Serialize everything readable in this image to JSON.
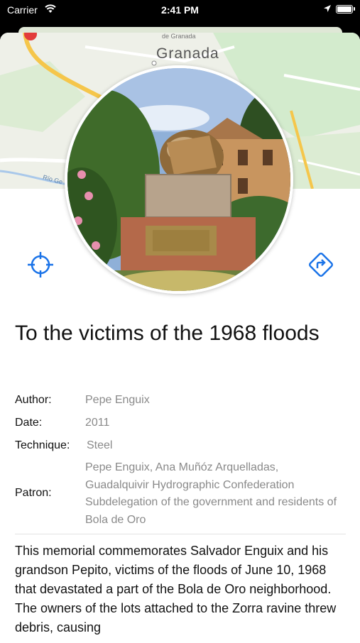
{
  "status_bar": {
    "carrier": "Carrier",
    "time": "2:41 PM"
  },
  "map": {
    "city_label": "Granada",
    "small_label": "de Granada",
    "river_label": "Río Ge"
  },
  "monument": {
    "title": "To the victims of the 1968 floods",
    "fields": {
      "author_label": "Author:",
      "author_value": "Pepe Enguix",
      "date_label": "Date:",
      "date_value": "2011",
      "technique_label": "Technique:",
      "technique_value": "Steel",
      "patron_label": "Patron:",
      "patron_value": "Pepe Enguix, Ana Muñóz Arquelladas, Guadalquivir Hydrographic Confederation Subdelegation of the government and residents of Bola de Oro"
    },
    "description": "This memorial commemorates Salvador Enguix and his grandson Pepito, victims of the floods of June 10, 1968 that devastated a part of the Bola de Oro neighborhood. The owners of the lots attached to the Zorra ravine threw debris, causing"
  },
  "colors": {
    "accent": "#1a73e8",
    "secondary_text": "#8a8a8a"
  },
  "icons": {
    "locate": "crosshair-icon",
    "directions": "directions-icon"
  }
}
